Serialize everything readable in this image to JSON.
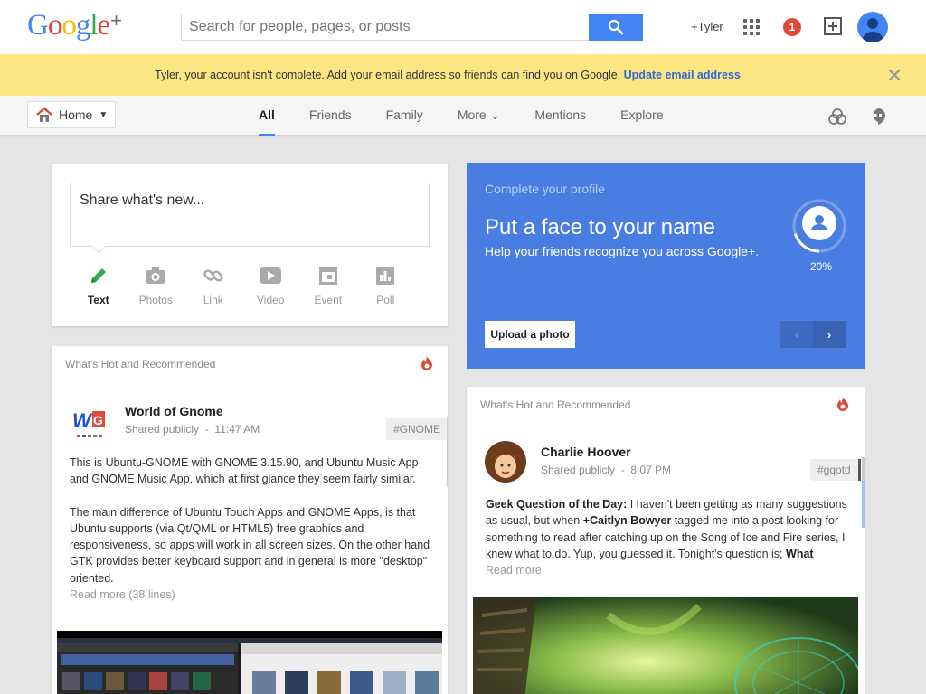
{
  "header": {
    "logo_text": "Google",
    "logo_plus": "+",
    "search_placeholder": "Search for people, pages, or posts",
    "user_label": "+Tyler",
    "notification_count": "1"
  },
  "notice": {
    "message": "Tyler, your account isn't complete. Add your email address so friends can find you on Google. ",
    "link": "Update email address",
    "close": "✕"
  },
  "nav": {
    "home_label": "Home",
    "tabs": [
      {
        "label": "All",
        "active": true
      },
      {
        "label": "Friends"
      },
      {
        "label": "Family"
      },
      {
        "label": "More ⌄"
      },
      {
        "label": "Mentions"
      },
      {
        "label": "Explore"
      }
    ]
  },
  "share": {
    "placeholder": "Share what's new...",
    "tools": [
      "Text",
      "Photos",
      "Link",
      "Video",
      "Event",
      "Poll"
    ]
  },
  "profile_card": {
    "title": "Complete your profile",
    "headline": "Put a face to your name",
    "subtext": "Help your friends recognize you across Google+.",
    "percent": "20%",
    "progress": 0.2,
    "upload_label": "Upload a photo",
    "prev": "‹",
    "next": "›"
  },
  "hot_left": {
    "label": "What's Hot and Recommended",
    "author": "World of Gnome",
    "visibility": "Shared publicly",
    "time": "11:47 AM",
    "tag": "#GNOME",
    "paragraph1": "This is Ubuntu-GNOME with GNOME 3.15.90, and Ubuntu Music App and GNOME Music App, which at first glance they seem fairly similar.",
    "paragraph2": "The main difference of Ubuntu Touch Apps and GNOME Apps, is that Ubuntu supports (via Qt/QML or HTML5) free graphics and responsiveness, so apps will work in all screen sizes. On the other hand GTK provides better keyboard support and in general is more \"desktop\" oriented.",
    "read_more": "Read more (38 lines)"
  },
  "hot_right": {
    "label": "What's Hot and Recommended",
    "author": "Charlie Hoover",
    "visibility": "Shared publicly",
    "time": "8:07 PM",
    "tag": "#gqotd",
    "body_bold": "Geek Question of the Day:",
    "body_1": " I haven't been getting as many suggestions as usual, but when ",
    "mention": "+Caitlyn Bowyer",
    "body_2": " tagged me into a post looking for something to read after catching up on the Song of Ice and Fire series, I knew what to do. Yup, you guessed it. Tonight's question is; ",
    "body_bold_2": "What",
    "read_more": "Read more"
  }
}
